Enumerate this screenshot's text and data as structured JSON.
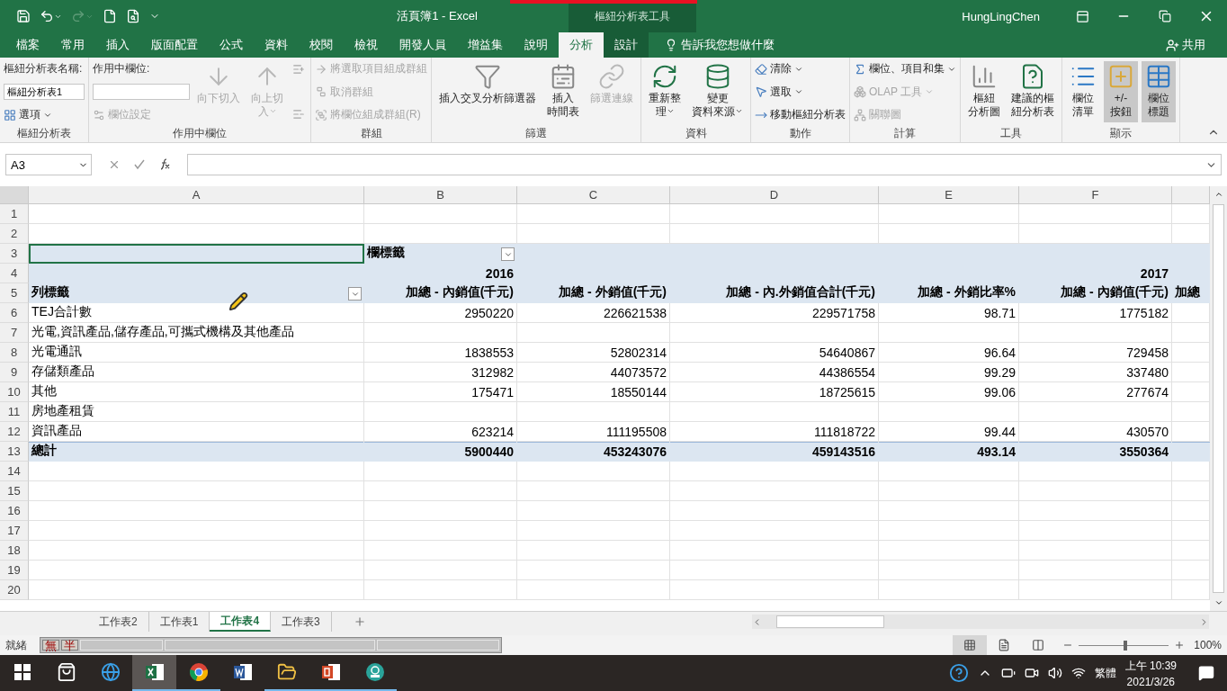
{
  "title_bar": {
    "title": "活頁簿1 - Excel",
    "context_title": "樞紐分析表工具",
    "user": "HungLingChen"
  },
  "tabs": [
    {
      "label": "檔案",
      "selected": false,
      "contextual": false
    },
    {
      "label": "常用",
      "selected": false,
      "contextual": false
    },
    {
      "label": "插入",
      "selected": false,
      "contextual": false
    },
    {
      "label": "版面配置",
      "selected": false,
      "contextual": false
    },
    {
      "label": "公式",
      "selected": false,
      "contextual": false
    },
    {
      "label": "資料",
      "selected": false,
      "contextual": false
    },
    {
      "label": "校閱",
      "selected": false,
      "contextual": false
    },
    {
      "label": "檢視",
      "selected": false,
      "contextual": false
    },
    {
      "label": "開發人員",
      "selected": false,
      "contextual": false
    },
    {
      "label": "增益集",
      "selected": false,
      "contextual": false
    },
    {
      "label": "說明",
      "selected": false,
      "contextual": false
    },
    {
      "label": "分析",
      "selected": true,
      "contextual": true
    },
    {
      "label": "設計",
      "selected": false,
      "contextual": true
    }
  ],
  "tell_me": "告訴我您想做什麼",
  "share": "共用",
  "ribbon": [
    {
      "label": "樞紐分析表",
      "columns": [
        [
          {
            "kind": "caption",
            "label": "樞紐分析表名稱:"
          },
          {
            "kind": "field",
            "value": "樞紐分析表1"
          },
          {
            "kind": "small",
            "label": "選項",
            "dropdown": true,
            "disabled": false
          }
        ]
      ]
    },
    {
      "label": "作用中欄位",
      "columns": [
        [
          {
            "kind": "caption",
            "label": "作用中欄位:"
          },
          {
            "kind": "field"
          },
          {
            "kind": "small",
            "label": "欄位設定",
            "dropdown": false,
            "disabled": true
          }
        ],
        [
          {
            "kind": "large",
            "label": [
              "向下切入"
            ],
            "dropdown": false,
            "disabled": true,
            "selected": false
          }
        ],
        [
          {
            "kind": "large",
            "label": [
              "向上切",
              "入"
            ],
            "dropdown": true,
            "disabled": true,
            "selected": false
          }
        ],
        [
          {
            "kind": "icon",
            "disabled": true
          },
          {
            "kind": "icon",
            "disabled": true
          }
        ]
      ]
    },
    {
      "label": "群組",
      "columns": [
        [
          {
            "kind": "small",
            "label": "將選取項目組成群組",
            "dropdown": false,
            "disabled": true
          },
          {
            "kind": "small",
            "label": "取消群組",
            "dropdown": false,
            "disabled": true
          },
          {
            "kind": "small",
            "label": "將欄位組成群組(R)",
            "dropdown": false,
            "disabled": true
          }
        ]
      ]
    },
    {
      "label": "篩選",
      "columns": [
        [
          {
            "kind": "large",
            "label": [
              "插入交叉分析篩選器"
            ],
            "dropdown": false,
            "disabled": false,
            "selected": false
          }
        ],
        [
          {
            "kind": "large",
            "label": [
              "插入",
              "時間表"
            ],
            "dropdown": false,
            "disabled": false,
            "selected": false
          }
        ],
        [
          {
            "kind": "large",
            "label": [
              "篩選連線"
            ],
            "dropdown": false,
            "disabled": true,
            "selected": false
          }
        ]
      ]
    },
    {
      "label": "資料",
      "columns": [
        [
          {
            "kind": "large",
            "label": [
              "重新整",
              "理"
            ],
            "dropdown": true,
            "disabled": false,
            "selected": false
          }
        ],
        [
          {
            "kind": "large",
            "label": [
              "變更",
              "資料來源"
            ],
            "dropdown": true,
            "disabled": false,
            "selected": false
          }
        ]
      ]
    },
    {
      "label": "動作",
      "columns": [
        [
          {
            "kind": "small",
            "label": "清除",
            "dropdown": true,
            "disabled": false
          },
          {
            "kind": "small",
            "label": "選取",
            "dropdown": true,
            "disabled": false
          },
          {
            "kind": "small",
            "label": "移動樞紐分析表",
            "dropdown": false,
            "disabled": false
          }
        ]
      ]
    },
    {
      "label": "計算",
      "columns": [
        [
          {
            "kind": "small",
            "label": "欄位、項目和集",
            "dropdown": true,
            "disabled": false
          },
          {
            "kind": "small",
            "label": "OLAP 工具",
            "dropdown": true,
            "disabled": true
          },
          {
            "kind": "small",
            "label": "關聯圖",
            "dropdown": false,
            "disabled": true
          }
        ]
      ]
    },
    {
      "label": "工具",
      "columns": [
        [
          {
            "kind": "large",
            "label": [
              "樞紐",
              "分析圖"
            ],
            "dropdown": false,
            "disabled": false,
            "selected": false
          }
        ],
        [
          {
            "kind": "large",
            "label": [
              "建議的樞",
              "紐分析表"
            ],
            "dropdown": false,
            "disabled": false,
            "selected": false
          }
        ]
      ]
    },
    {
      "label": "顯示",
      "columns": [
        [
          {
            "kind": "large",
            "label": [
              "欄位",
              "清單"
            ],
            "dropdown": false,
            "disabled": false,
            "selected": false
          }
        ],
        [
          {
            "kind": "large",
            "label": [
              "+/-",
              "按鈕"
            ],
            "dropdown": false,
            "disabled": false,
            "selected": true
          }
        ],
        [
          {
            "kind": "large",
            "label": [
              "欄位",
              "標題"
            ],
            "dropdown": false,
            "disabled": false,
            "selected": true
          }
        ]
      ]
    }
  ],
  "formula_bar": {
    "name_box": "A3"
  },
  "sheet": {
    "columns": [
      {
        "letter": "A"
      },
      {
        "letter": "B"
      },
      {
        "letter": "C"
      },
      {
        "letter": "D"
      },
      {
        "letter": "E"
      },
      {
        "letter": "F"
      }
    ],
    "rows": [
      {
        "number": "1",
        "kind": "plain",
        "cells": {}
      },
      {
        "number": "2",
        "kind": "plain",
        "cells": {}
      },
      {
        "number": "3",
        "kind": "pivot-header",
        "cells": {
          "A": {
            "selected": true,
            "filter": false
          },
          "B": {
            "text": "欄標籤",
            "selected": false,
            "filter": true
          }
        }
      },
      {
        "number": "4",
        "kind": "pivot-header",
        "cells": {
          "B": "2016",
          "F": "2017"
        }
      },
      {
        "number": "5",
        "kind": "pivot-header",
        "cells": {
          "A": {
            "text": "列標籤",
            "selected": false,
            "filter": true
          },
          "B": "加總 - 內銷值(千元)",
          "C": "加總 - 外銷值(千元)",
          "D": "加總 - 內.外銷值合計(千元)",
          "E": "加總 - 外銷比率%",
          "F": "加總 - 內銷值(千元)",
          "G": "加總"
        }
      },
      {
        "number": "6",
        "kind": "pivot-item",
        "cells": {
          "A": "TEJ合計數",
          "B": "2950220",
          "C": "226621538",
          "D": "229571758",
          "E": "98.71",
          "F": "1775182"
        }
      },
      {
        "number": "7",
        "kind": "pivot-item",
        "cells": {
          "A": "光電,資訊產品,儲存產品,可攜式機構及其他產品"
        }
      },
      {
        "number": "8",
        "kind": "pivot-item",
        "cells": {
          "A": "光電通訊",
          "B": "1838553",
          "C": "52802314",
          "D": "54640867",
          "E": "96.64",
          "F": "729458"
        }
      },
      {
        "number": "9",
        "kind": "pivot-item",
        "cells": {
          "A": "存儲類產品",
          "B": "312982",
          "C": "44073572",
          "D": "44386554",
          "E": "99.29",
          "F": "337480"
        }
      },
      {
        "number": "10",
        "kind": "pivot-item",
        "cells": {
          "A": "其他",
          "B": "175471",
          "C": "18550144",
          "D": "18725615",
          "E": "99.06",
          "F": "277674"
        }
      },
      {
        "number": "11",
        "kind": "pivot-item",
        "cells": {
          "A": "房地產租賃"
        }
      },
      {
        "number": "12",
        "kind": "pivot-item",
        "cells": {
          "A": "資訊產品",
          "B": "623214",
          "C": "111195508",
          "D": "111818722",
          "E": "99.44",
          "F": "430570"
        }
      },
      {
        "number": "13",
        "kind": "pivot-total",
        "cells": {
          "A": "總計",
          "B": "5900440",
          "C": "453243076",
          "D": "459143516",
          "E": "493.14",
          "F": "3550364"
        }
      },
      {
        "number": "14",
        "kind": "plain",
        "cells": {}
      },
      {
        "number": "15",
        "kind": "plain",
        "cells": {}
      },
      {
        "number": "16",
        "kind": "plain",
        "cells": {}
      },
      {
        "number": "17",
        "kind": "plain",
        "cells": {}
      },
      {
        "number": "18",
        "kind": "plain",
        "cells": {}
      },
      {
        "number": "19",
        "kind": "plain",
        "cells": {}
      },
      {
        "number": "20",
        "kind": "plain",
        "cells": {}
      }
    ]
  },
  "sheet_tabs": [
    {
      "label": "工作表2",
      "selected": false
    },
    {
      "label": "工作表1",
      "selected": false
    },
    {
      "label": "工作表4",
      "selected": true
    },
    {
      "label": "工作表3",
      "selected": false
    }
  ],
  "ime_bar": [
    "無",
    "半"
  ],
  "status_bar": {
    "status": "就緒",
    "views": [
      {
        "selected": true
      },
      {
        "selected": false
      },
      {
        "selected": false
      }
    ],
    "zoom": {
      "level": 0.52,
      "reading": "100%"
    }
  },
  "taskbar": {
    "apps": [
      {
        "running": false,
        "selected": false
      },
      {
        "running": false,
        "selected": false
      },
      {
        "running": false,
        "selected": false
      },
      {
        "running": true,
        "selected": true
      },
      {
        "running": true,
        "selected": false
      },
      {
        "running": false,
        "selected": false
      },
      {
        "running": true,
        "selected": false
      },
      {
        "running": true,
        "selected": false
      },
      {
        "running": true,
        "selected": false
      }
    ],
    "language": "繁體",
    "time": "上午 10:39",
    "date": "2021/3/26"
  }
}
